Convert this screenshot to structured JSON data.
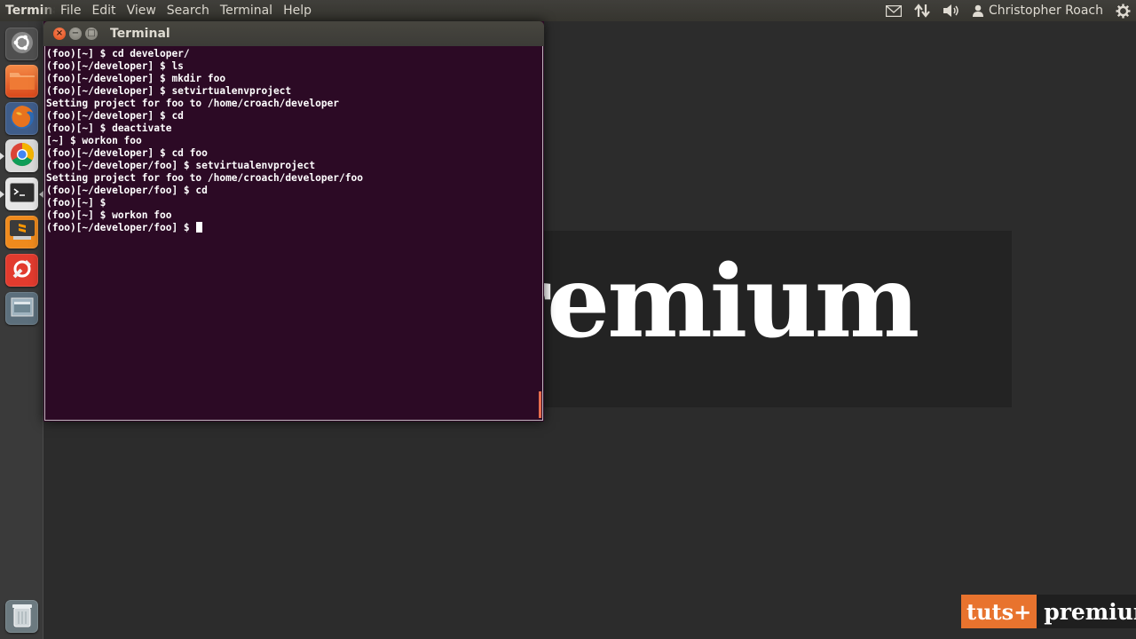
{
  "top_panel": {
    "app_name": "Terminal",
    "menus": [
      "File",
      "Edit",
      "View",
      "Search",
      "Terminal",
      "Help"
    ],
    "user_name": "Christopher Roach"
  },
  "launcher": {
    "items": [
      {
        "name": "dash-home",
        "icon": "ubuntu-logo-icon"
      },
      {
        "name": "files",
        "icon": "folder-icon"
      },
      {
        "name": "firefox",
        "icon": "firefox-icon"
      },
      {
        "name": "chrome",
        "icon": "chrome-icon"
      },
      {
        "name": "terminal",
        "icon": "terminal-icon"
      },
      {
        "name": "sublime-text",
        "icon": "sublime-icon"
      },
      {
        "name": "settings",
        "icon": "system-settings-icon"
      },
      {
        "name": "workspaces",
        "icon": "workspace-switcher-icon"
      },
      {
        "name": "trash",
        "icon": "trash-icon"
      }
    ]
  },
  "window": {
    "title": "Terminal"
  },
  "terminal": {
    "lines": [
      "(foo)[~] $ cd developer/",
      "(foo)[~/developer] $ ls",
      "(foo)[~/developer] $ mkdir foo",
      "(foo)[~/developer] $ setvirtualenvproject",
      "Setting project for foo to /home/croach/developer",
      "(foo)[~/developer] $ cd",
      "(foo)[~] $ deactivate",
      "[~] $ workon foo",
      "(foo)[~/developer] $ cd foo",
      "(foo)[~/developer/foo] $ setvirtualenvproject",
      "Setting project for foo to /home/croach/developer/foo",
      "(foo)[~/developer/foo] $ cd",
      "(foo)[~] $",
      "(foo)[~] $ workon foo"
    ],
    "prompt": "(foo)[~/developer/foo] $ "
  },
  "wallpaper": {
    "big_text": "remium",
    "brand_left": "tuts+",
    "brand_right": "premium"
  },
  "colors": {
    "panel": "#3c3b37",
    "terminal_bg": "#2c0a25",
    "accent": "#df4a16",
    "brand_orange": "#e8732e"
  }
}
